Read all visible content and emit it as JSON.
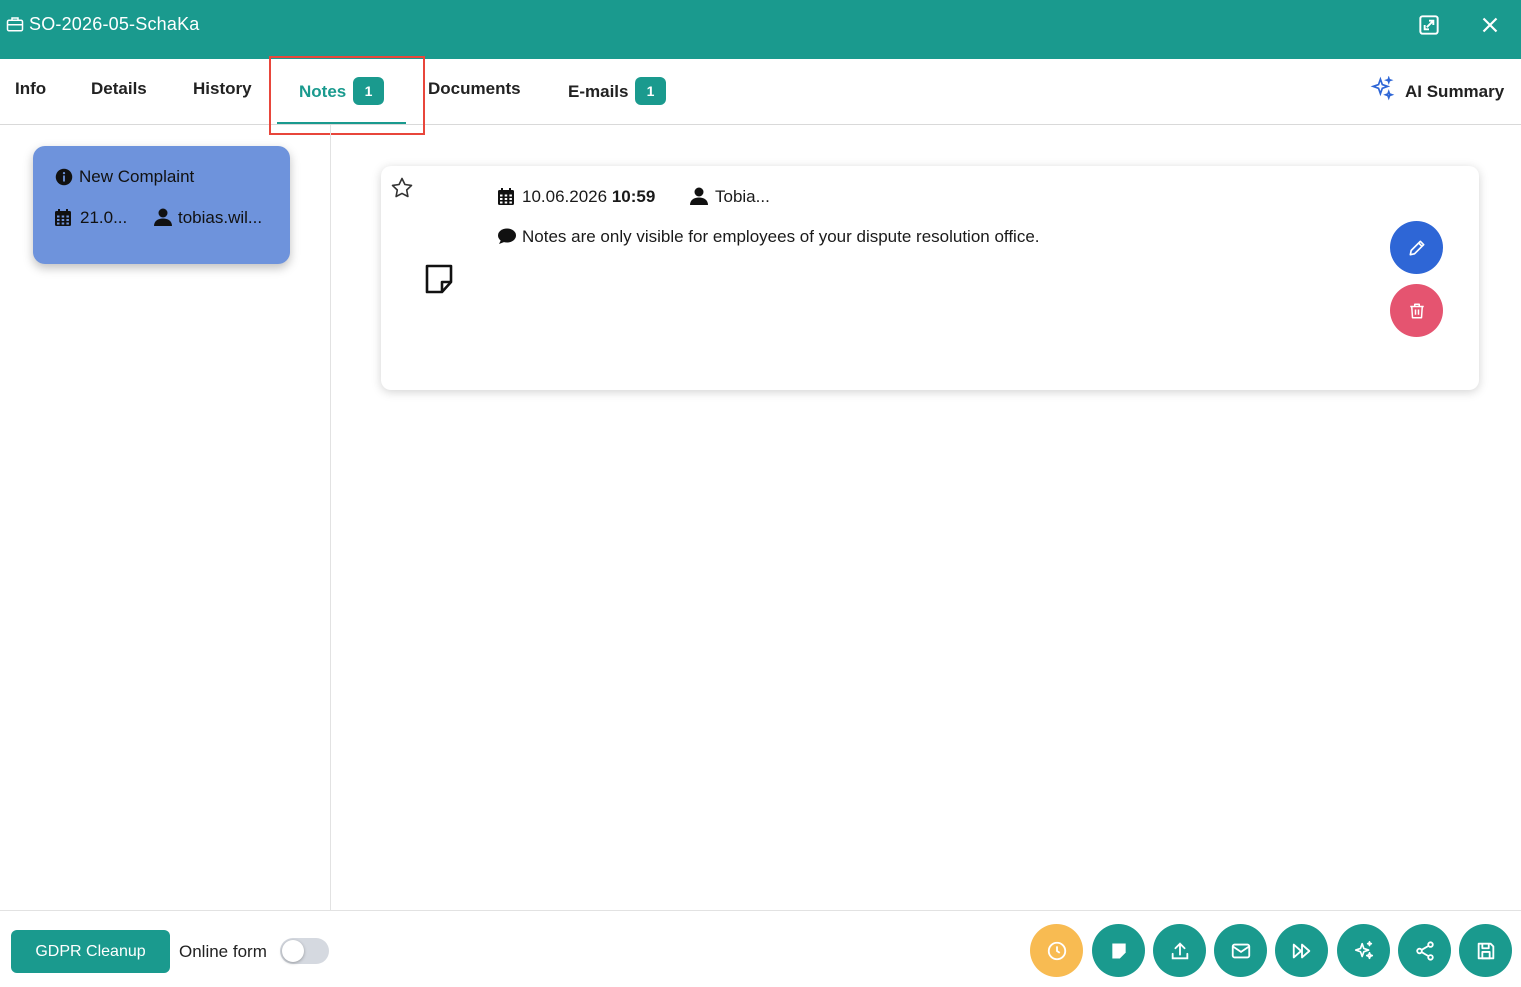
{
  "window": {
    "title": "SO-2026-05-SchaKa"
  },
  "tabs": [
    {
      "label": "Info"
    },
    {
      "label": "Details"
    },
    {
      "label": "History"
    },
    {
      "label": "Notes",
      "badge": "1",
      "active": true
    },
    {
      "label": "Documents"
    },
    {
      "label": "E-mails",
      "badge": "1"
    }
  ],
  "ai_summary": {
    "label": "AI Summary"
  },
  "note_list": [
    {
      "title": "New Complaint",
      "date": "21.0...",
      "user": "tobias.wil..."
    }
  ],
  "note_detail": {
    "date": "10.06.2026",
    "time": "10:59",
    "author": "Tobia...",
    "message": "Notes are only visible for employees of your dispute resolution office."
  },
  "bottom": {
    "gdpr_label": "GDPR Cleanup",
    "online_form_label": "Online form",
    "online_form_enabled": false
  },
  "colors": {
    "primary": "#1a9a8e",
    "note_card": "#6e93dc",
    "edit": "#2e66d6",
    "delete": "#e55470",
    "timer": "#f8bb52",
    "highlight": "#e8463b"
  },
  "icons": {
    "actions": [
      "clock-icon",
      "note-icon",
      "upload-icon",
      "mail-icon",
      "fast-forward-icon",
      "sparkle-icon",
      "share-icon",
      "save-icon"
    ]
  }
}
